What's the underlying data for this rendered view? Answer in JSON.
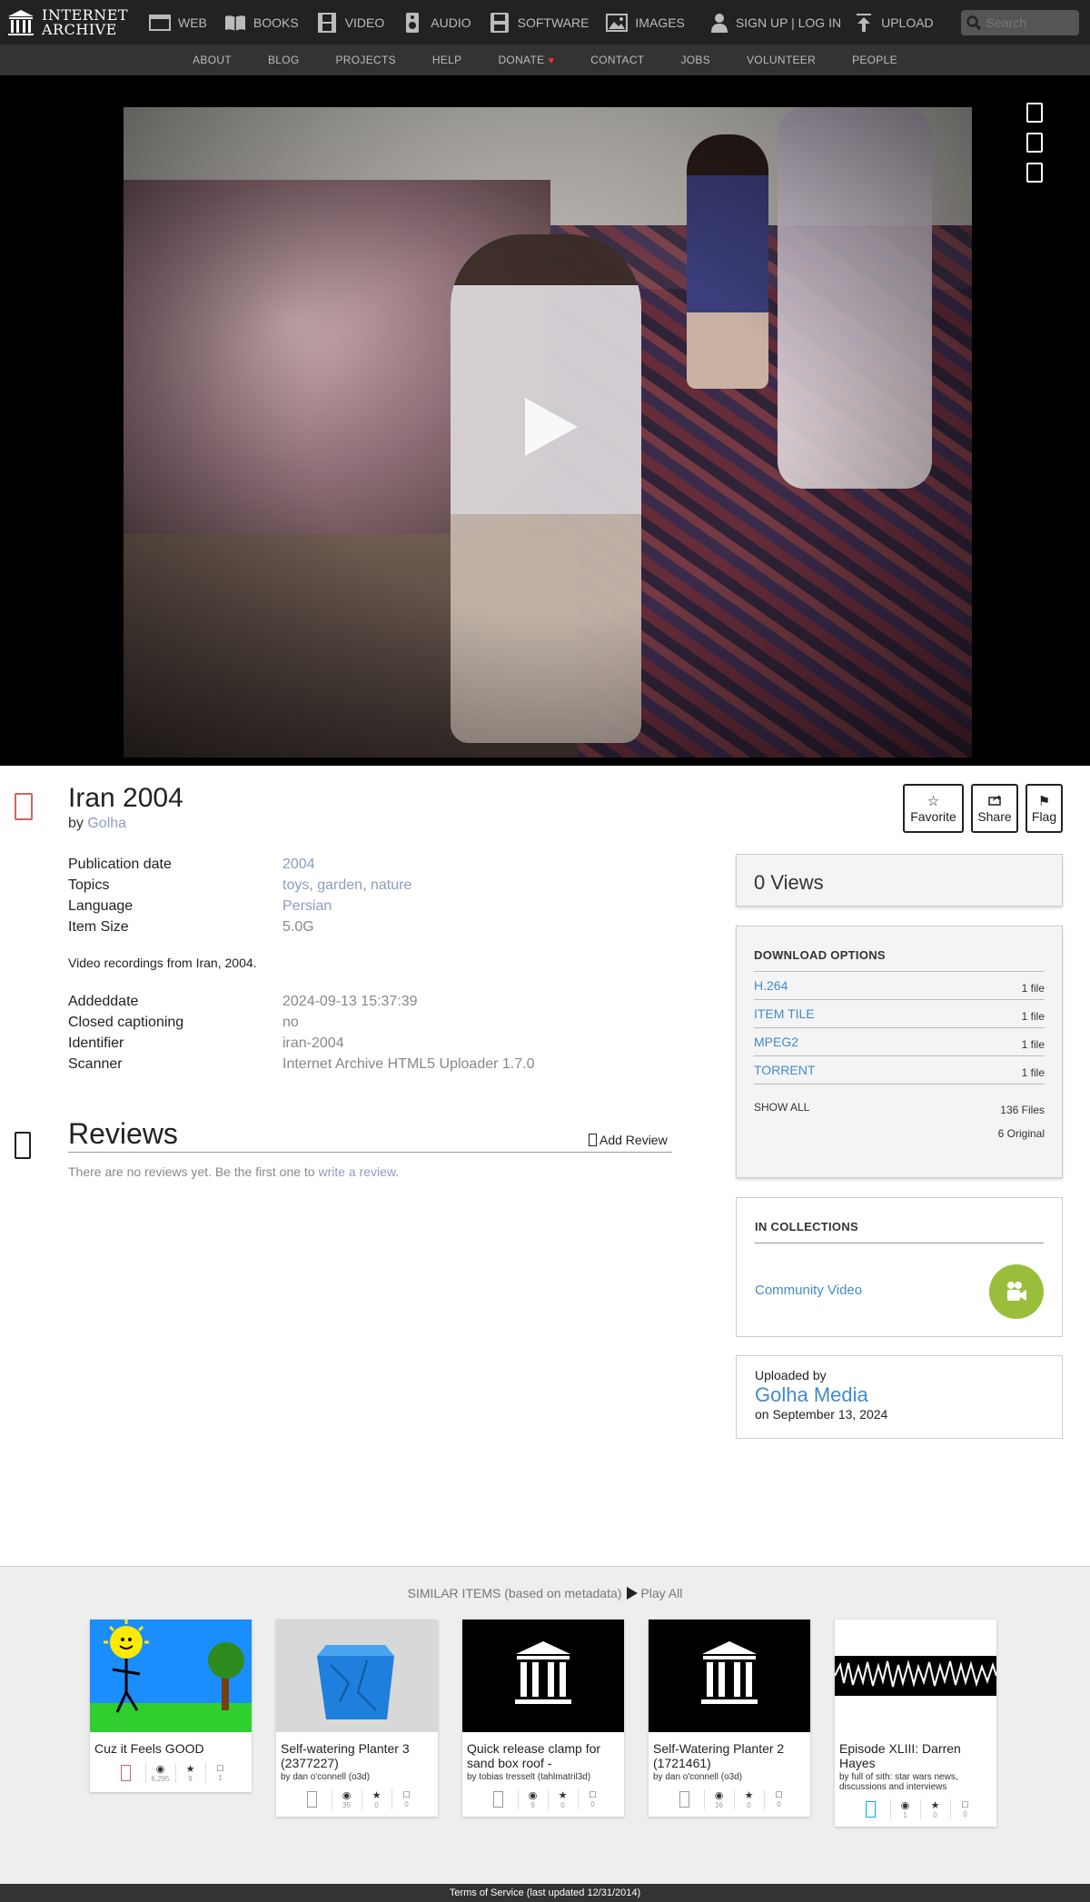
{
  "nav": {
    "logo_line1": "INTERNET",
    "logo_line2": "ARCHIVE",
    "items": [
      {
        "label": "WEB",
        "icon": "web-icon"
      },
      {
        "label": "BOOKS",
        "icon": "books-icon"
      },
      {
        "label": "VIDEO",
        "icon": "film-icon"
      },
      {
        "label": "AUDIO",
        "icon": "speaker-icon"
      },
      {
        "label": "SOFTWARE",
        "icon": "floppy-icon"
      },
      {
        "label": "IMAGES",
        "icon": "picture-icon"
      }
    ],
    "signup": "SIGN UP | LOG IN",
    "upload": "UPLOAD",
    "search_placeholder": "Search"
  },
  "subnav": [
    "ABOUT",
    "BLOG",
    "PROJECTS",
    "HELP",
    "DONATE",
    "CONTACT",
    "JOBS",
    "VOLUNTEER",
    "PEOPLE"
  ],
  "item": {
    "title": "Iran 2004",
    "by_prefix": "by",
    "creator": "Golha",
    "actions": {
      "favorite": "Favorite",
      "share": "Share",
      "flag": "Flag"
    },
    "metadata": [
      {
        "key": "Publication date",
        "value": "2004"
      },
      {
        "key": "Topics",
        "value": [
          "toys",
          "garden",
          "nature"
        ]
      },
      {
        "key": "Language",
        "value": "Persian"
      },
      {
        "key": "Item Size",
        "value": "5.0G"
      }
    ],
    "description": "Video recordings from Iran, 2004.",
    "metadata2": [
      {
        "key": "Addeddate",
        "value": "2024-09-13 15:37:39"
      },
      {
        "key": "Closed captioning",
        "value": "no"
      },
      {
        "key": "Identifier",
        "value": "iran-2004"
      },
      {
        "key": "Scanner",
        "value": "Internet Archive HTML5 Uploader 1.7.0"
      }
    ]
  },
  "reviews": {
    "title": "Reviews",
    "add_label": "Add Review",
    "empty_text": "There are no reviews yet. Be the first one to",
    "write_link": "write a review",
    "period": "."
  },
  "sidebar": {
    "views": "0 Views",
    "download_title": "DOWNLOAD OPTIONS",
    "downloads": [
      {
        "label": "H.264",
        "count": "1 file"
      },
      {
        "label": "ITEM TILE",
        "count": "1 file"
      },
      {
        "label": "MPEG2",
        "count": "1 file"
      },
      {
        "label": "TORRENT",
        "count": "1 file"
      }
    ],
    "show_all": "SHOW ALL",
    "total_files": "136 Files",
    "original_files": "6 Original",
    "collections_title": "IN COLLECTIONS",
    "collection": "Community Video",
    "uploaded_by_label": "Uploaded by",
    "uploader": "Golha Media",
    "uploaded_on": "on September 13, 2024"
  },
  "similar": {
    "heading": "SIMILAR ITEMS (based on metadata)",
    "play_all": "Play All",
    "items": [
      {
        "title": "Cuz it Feels GOOD",
        "by": "",
        "stats": [
          "6,295",
          "9",
          "1"
        ]
      },
      {
        "title": "Self-watering Planter 3 (2377227)",
        "by": "by dan o'connell (o3d)",
        "stats": [
          "35",
          "0",
          "0"
        ]
      },
      {
        "title": "Quick release clamp for sand box roof -",
        "by": "by tobias tresselt (tahlmatril3d)",
        "stats": [
          "9",
          "0",
          "0"
        ]
      },
      {
        "title": "Self-Watering Planter 2 (1721461)",
        "by": "by dan o'connell (o3d)",
        "stats": [
          "16",
          "0",
          "0"
        ]
      },
      {
        "title": "Episode XLIII: Darren Hayes",
        "by": "by full of sith: star wars news, discussions and interviews",
        "stats": [
          "1",
          "0",
          "0"
        ]
      }
    ]
  },
  "footer": "Terms of Service (last updated 12/31/2014)"
}
